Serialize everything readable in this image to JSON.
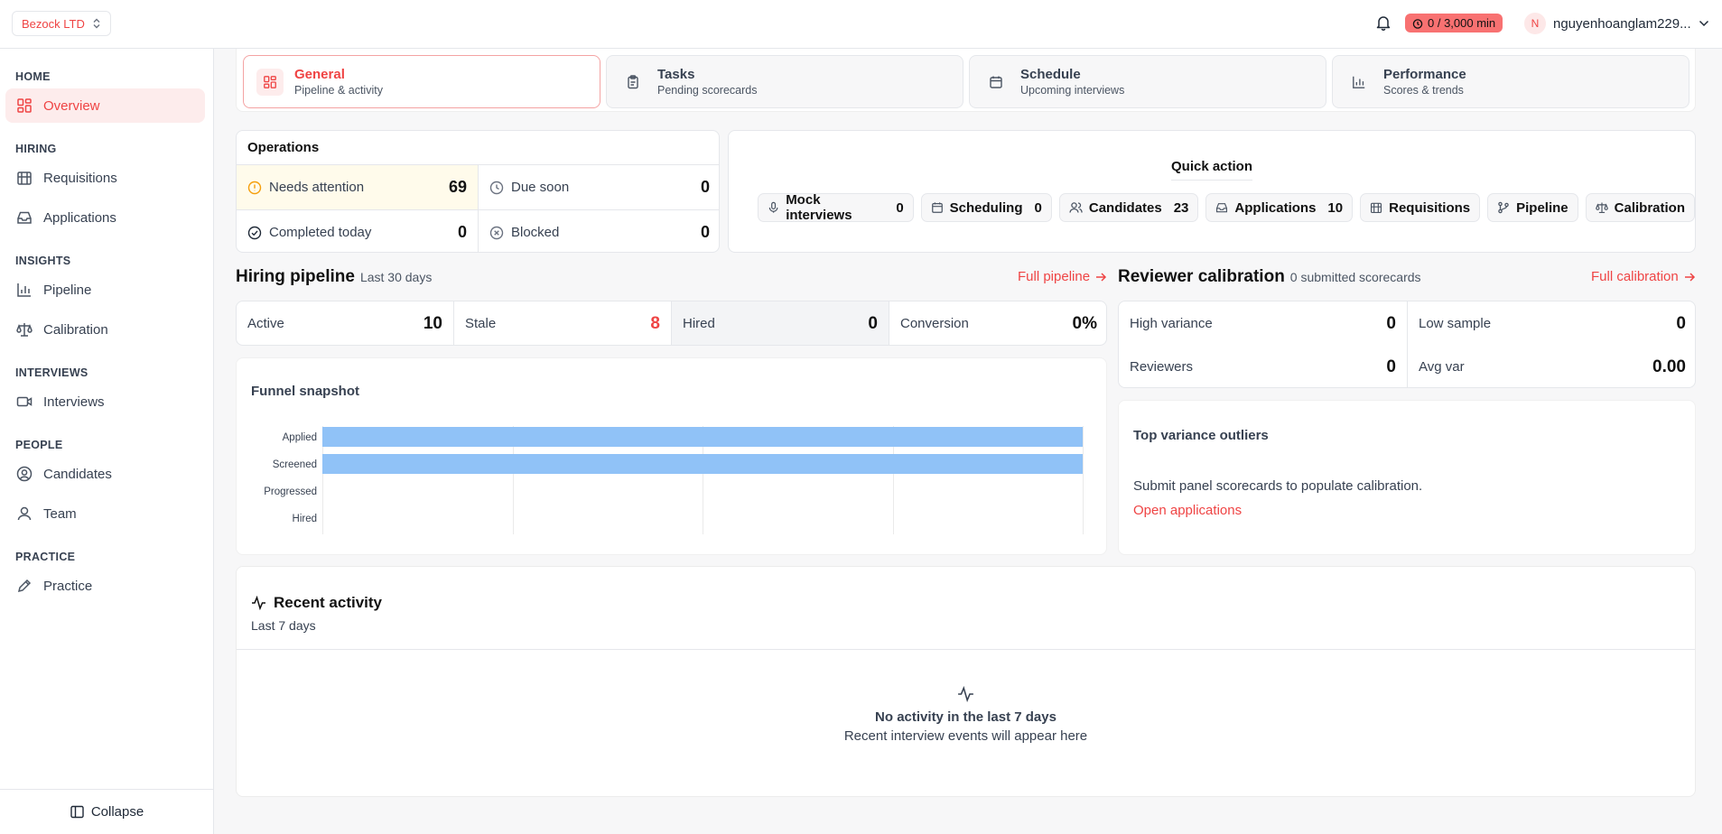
{
  "org": {
    "name": "Bezock LTD"
  },
  "header": {
    "timer": "0 / 3,000 min",
    "avatar_initial": "N",
    "username": "nguyenhoanglam229..."
  },
  "sidebar": {
    "sections": [
      "HOME",
      "HIRING",
      "INSIGHTS",
      "INTERVIEWS",
      "PEOPLE",
      "PRACTICE"
    ],
    "items": [
      "Overview",
      "Requisitions",
      "Applications",
      "Pipeline",
      "Calibration",
      "Interviews",
      "Candidates",
      "Team",
      "Practice"
    ],
    "collapse": "Collapse"
  },
  "tabs": [
    {
      "title": "General",
      "sub": "Pipeline & activity"
    },
    {
      "title": "Tasks",
      "sub": "Pending scorecards"
    },
    {
      "title": "Schedule",
      "sub": "Upcoming interviews"
    },
    {
      "title": "Performance",
      "sub": "Scores & trends"
    }
  ],
  "operations": {
    "title": "Operations",
    "needs_attention": {
      "label": "Needs attention",
      "value": "69"
    },
    "due_soon": {
      "label": "Due soon",
      "value": "0"
    },
    "completed_today": {
      "label": "Completed today",
      "value": "0"
    },
    "blocked": {
      "label": "Blocked",
      "value": "0"
    }
  },
  "quick_action": {
    "title": "Quick action",
    "buttons": [
      {
        "label": "Mock interviews",
        "count": "0"
      },
      {
        "label": "Scheduling",
        "count": "0"
      },
      {
        "label": "Candidates",
        "count": "23"
      },
      {
        "label": "Applications",
        "count": "10"
      },
      {
        "label": "Requisitions"
      },
      {
        "label": "Pipeline"
      },
      {
        "label": "Calibration"
      }
    ]
  },
  "pipeline": {
    "title": "Hiring pipeline",
    "subtitle": "Last 30 days",
    "link": "Full pipeline",
    "stats": [
      {
        "label": "Active",
        "value": "10"
      },
      {
        "label": "Stale",
        "value": "8"
      },
      {
        "label": "Hired",
        "value": "0"
      },
      {
        "label": "Conversion",
        "value": "0%"
      }
    ]
  },
  "calibration": {
    "title": "Reviewer calibration",
    "subtitle": "0 submitted scorecards",
    "link": "Full calibration",
    "stats": [
      {
        "label": "High variance",
        "value": "0"
      },
      {
        "label": "Low sample",
        "value": "0"
      },
      {
        "label": "Reviewers",
        "value": "0"
      },
      {
        "label": "Avg var",
        "value": "0.00"
      }
    ],
    "outliers_title": "Top variance outliers",
    "outliers_message": "Submit panel scorecards to populate calibration.",
    "outliers_link": "Open applications"
  },
  "chart_data": {
    "type": "bar",
    "orientation": "horizontal",
    "title": "Funnel snapshot",
    "categories": [
      "Applied",
      "Screened",
      "Progressed",
      "Hired"
    ],
    "values": [
      10,
      10,
      0,
      0
    ],
    "xlim": [
      0,
      10
    ],
    "grid": true,
    "color": "#90c2f7"
  },
  "activity": {
    "title": "Recent activity",
    "subtitle": "Last 7 days",
    "empty_title": "No activity in the last 7 days",
    "empty_sub": "Recent interview events will appear here"
  },
  "colors": {
    "accent": "#ef4444",
    "bar": "#90c2f7",
    "badge": "#f87171"
  }
}
